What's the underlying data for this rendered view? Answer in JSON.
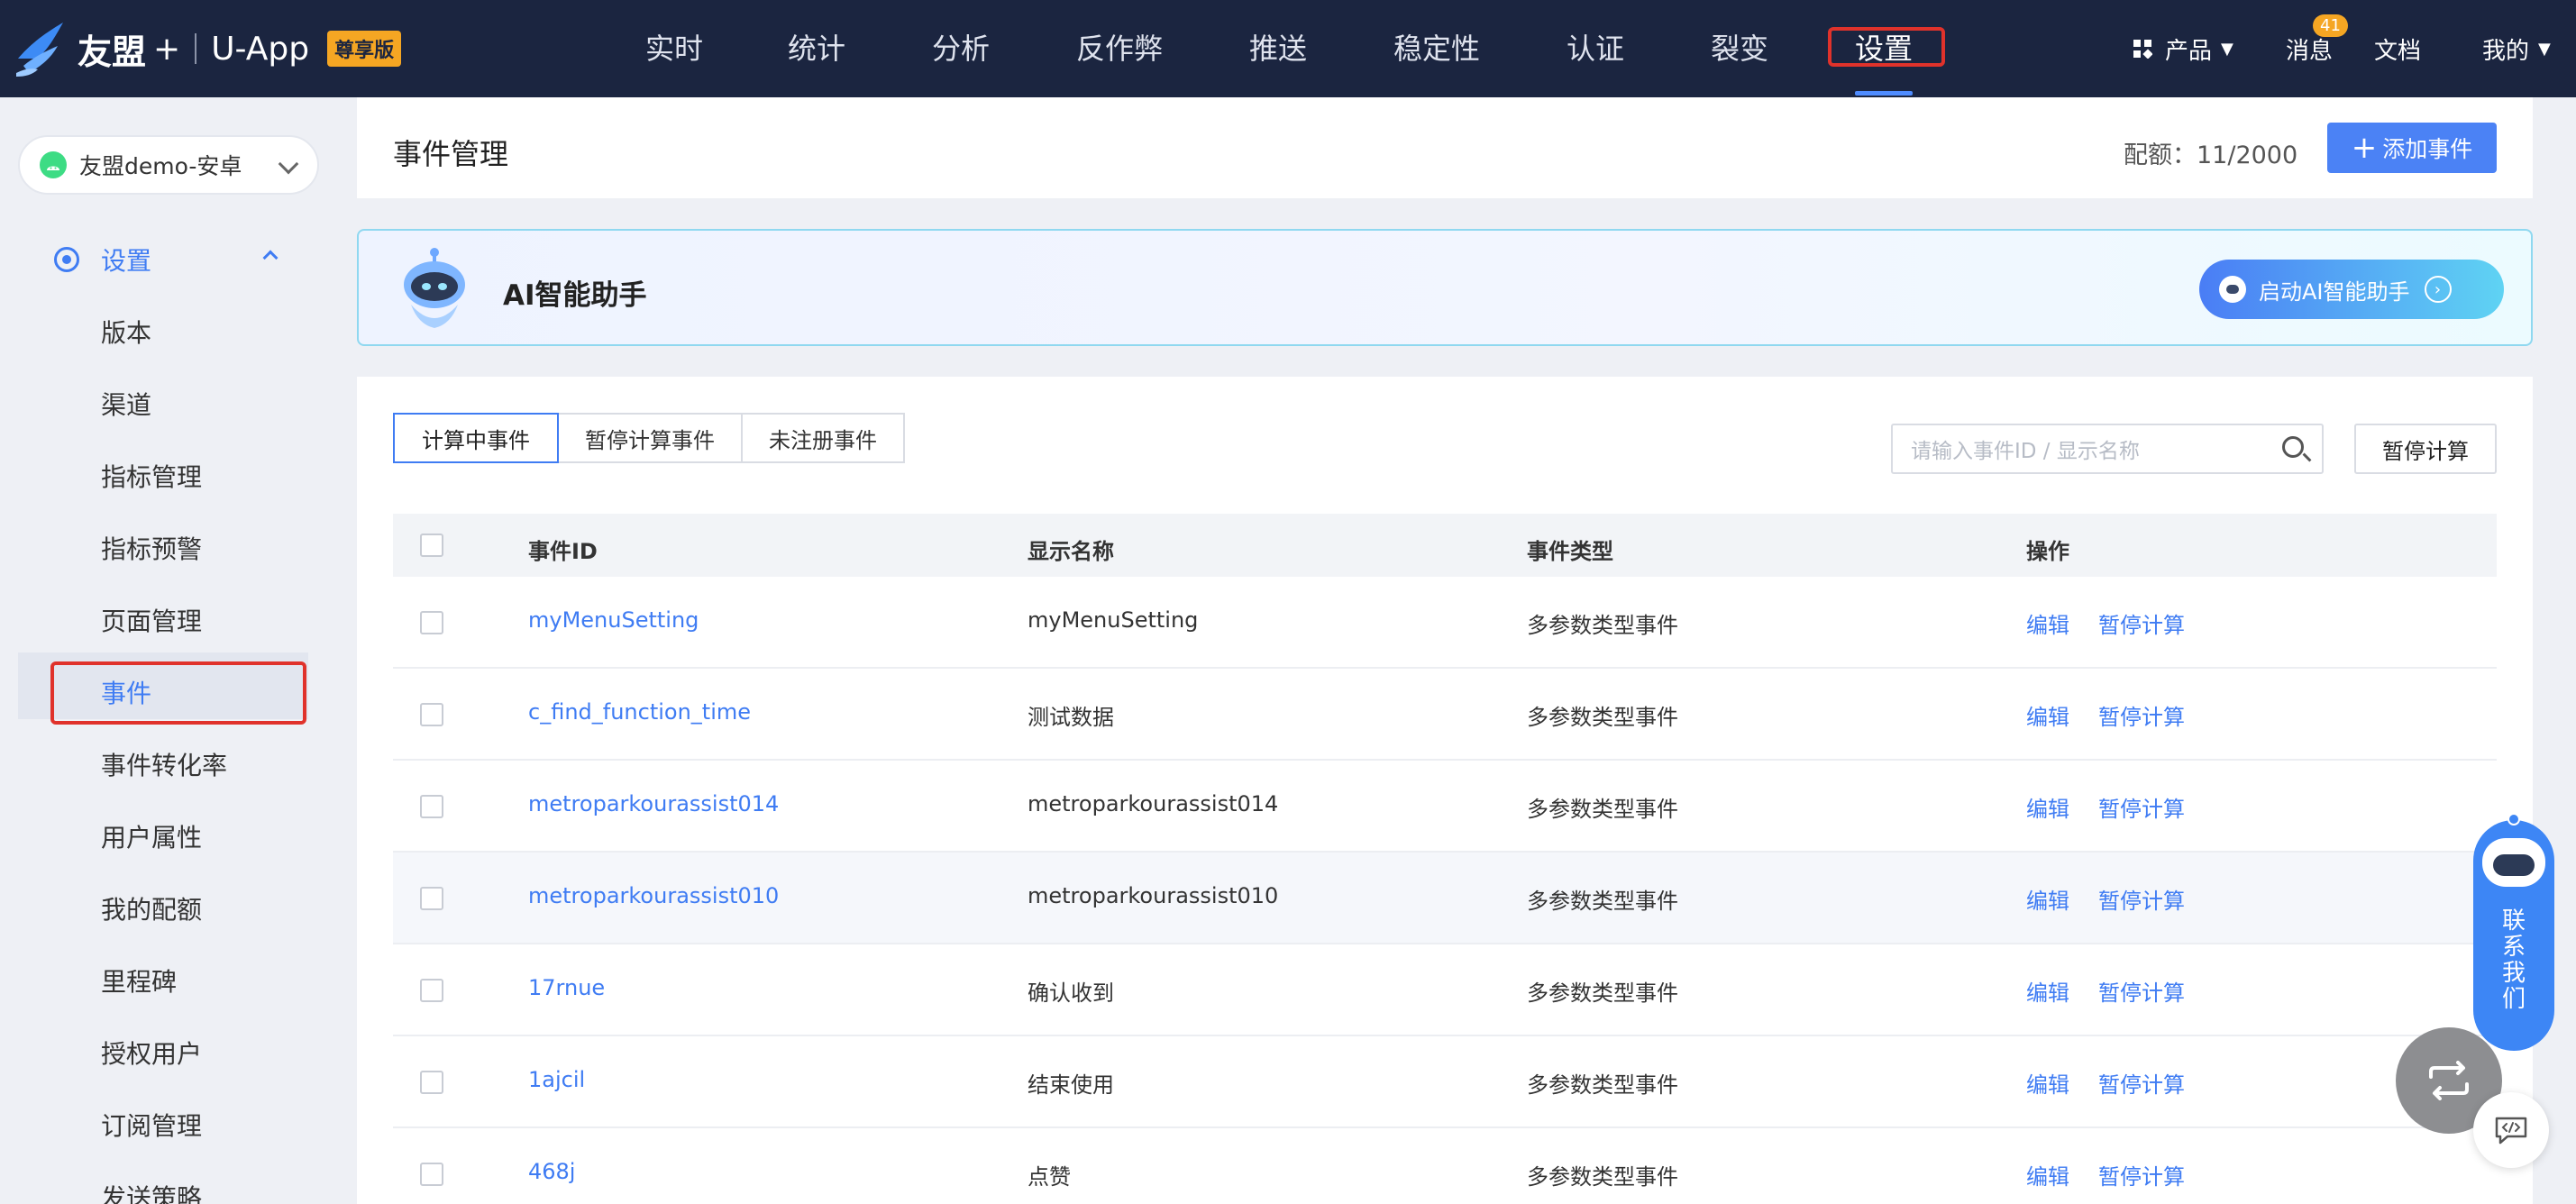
{
  "brand": {
    "name": "友盟",
    "plus": "+",
    "app": "U-App",
    "edition": "尊享版"
  },
  "nav": {
    "items": [
      "实时",
      "统计",
      "分析",
      "反作弊",
      "推送",
      "稳定性",
      "认证",
      "裂变",
      "设置"
    ],
    "active": "设置"
  },
  "top_right": {
    "products_label": "产品",
    "messages_label": "消息",
    "messages_count": "41",
    "docs_label": "文档",
    "mine_label": "我的"
  },
  "sidebar": {
    "app_select": "友盟demo-安卓",
    "group_label": "设置",
    "items": [
      "版本",
      "渠道",
      "指标管理",
      "指标预警",
      "页面管理",
      "事件",
      "事件转化率",
      "用户属性",
      "我的配额",
      "里程碑",
      "授权用户",
      "订阅管理",
      "发送策略"
    ],
    "active": "事件"
  },
  "header": {
    "title": "事件管理",
    "quota": "配额：11/2000",
    "add_label": "添加事件"
  },
  "ai_card": {
    "title": "AI智能助手",
    "button_label": "启动AI智能助手"
  },
  "tabs": [
    "计算中事件",
    "暂停计算事件",
    "未注册事件"
  ],
  "search": {
    "placeholder": "请输入事件ID / 显示名称"
  },
  "pause_all_label": "暂停计算",
  "table": {
    "columns": [
      "事件ID",
      "显示名称",
      "事件类型",
      "操作"
    ],
    "rows": [
      {
        "id": "myMenuSetting",
        "name": "myMenuSetting",
        "type": "多参数类型事件",
        "op1": "编辑",
        "op2": "暂停计算"
      },
      {
        "id": "c_find_function_time",
        "name": "测试数据",
        "type": "多参数类型事件",
        "op1": "编辑",
        "op2": "暂停计算"
      },
      {
        "id": "metroparkourassist014",
        "name": "metroparkourassist014",
        "type": "多参数类型事件",
        "op1": "编辑",
        "op2": "暂停计算"
      },
      {
        "id": "metroparkourassist010",
        "name": "metroparkourassist010",
        "type": "多参数类型事件",
        "op1": "编辑",
        "op2": "暂停计算"
      },
      {
        "id": "17rnue",
        "name": "确认收到",
        "type": "多参数类型事件",
        "op1": "编辑",
        "op2": "暂停计算"
      },
      {
        "id": "1ajcil",
        "name": "结束使用",
        "type": "多参数类型事件",
        "op1": "编辑",
        "op2": "暂停计算"
      },
      {
        "id": "468j",
        "name": "点赞",
        "type": "多参数类型事件",
        "op1": "编辑",
        "op2": "暂停计算"
      }
    ]
  },
  "float_contact_label": [
    "联",
    "系",
    "我",
    "们"
  ],
  "colors": {
    "topbar": "#1b2540",
    "accent": "#3f7cf3",
    "highlight_box": "#e0322b",
    "edition_badge": "#f5a623"
  }
}
